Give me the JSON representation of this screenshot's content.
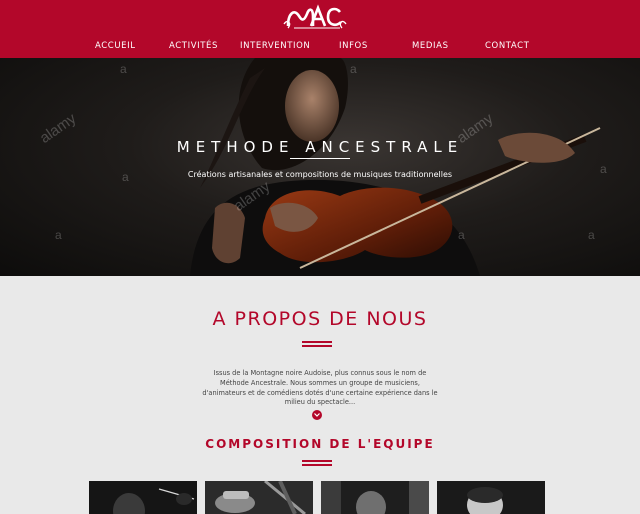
{
  "brand": {
    "logo_icon": "mac-monogram-logo",
    "primary_color": "#b3072a"
  },
  "nav": {
    "items": [
      {
        "label": "ACCUEIL"
      },
      {
        "label": "ACTIVITÉS"
      },
      {
        "label": "INTERVENTION"
      },
      {
        "label": "INFOS"
      },
      {
        "label": "MEDIAS"
      },
      {
        "label": "CONTACT"
      }
    ]
  },
  "hero": {
    "title": "METHODE ANCESTRALE",
    "subtitle": "Créations artisanales et compositions de musiques traditionnelles",
    "watermark": "alamy",
    "watermark_mark": "a"
  },
  "about": {
    "title": "A PROPOS DE NOUS",
    "text": "Issus de la Montagne noire Audoise, plus connus sous le nom de Méthode Ancestrale. Nous sommes un groupe de musiciens, d'animateurs et de comédiens dotés d'une certaine expérience dans le milieu du spectacle...",
    "more_icon": "chevron-down-icon"
  },
  "team": {
    "title": "COMPOSITION DE L'EQUIPE",
    "members": [
      {
        "photo": "member-photo-1"
      },
      {
        "photo": "member-photo-2"
      },
      {
        "photo": "member-photo-3"
      },
      {
        "photo": "member-photo-4"
      }
    ]
  }
}
